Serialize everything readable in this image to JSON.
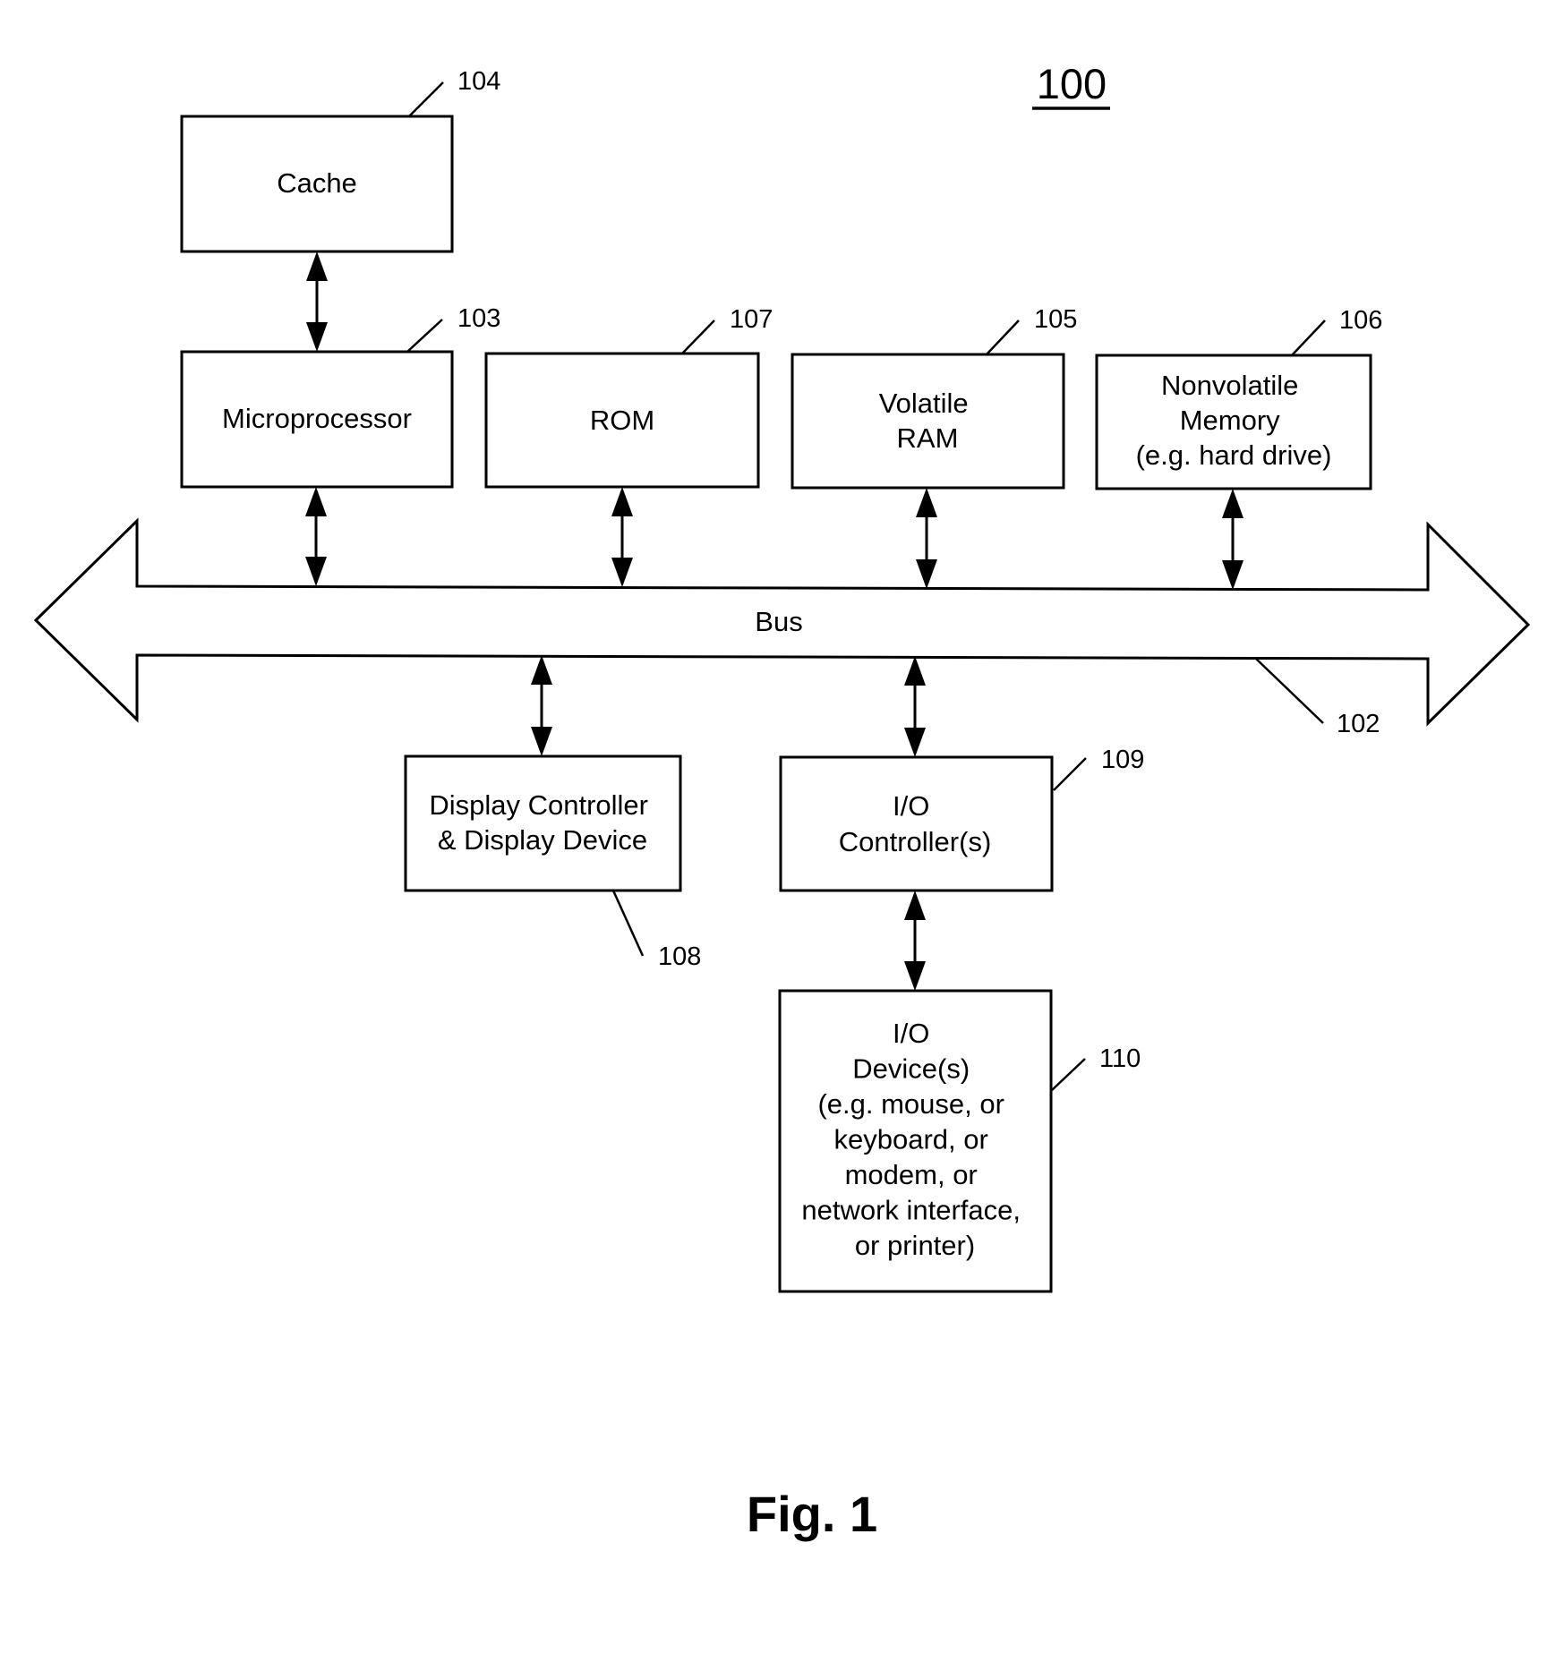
{
  "figure": {
    "number": "100",
    "caption": "Fig. 1"
  },
  "bus": {
    "label": "Bus",
    "ref": "102"
  },
  "blocks": {
    "cache": {
      "ref": "104",
      "lines": [
        "Cache"
      ]
    },
    "microprocessor": {
      "ref": "103",
      "lines": [
        "Microprocessor"
      ]
    },
    "rom": {
      "ref": "107",
      "lines": [
        "ROM"
      ]
    },
    "volatile_ram": {
      "ref": "105",
      "lines": [
        "Volatile",
        "RAM"
      ]
    },
    "nonvolatile_memory": {
      "ref": "106",
      "lines": [
        "Nonvolatile",
        "Memory",
        "(e.g. hard drive)"
      ]
    },
    "display": {
      "ref": "108",
      "lines": [
        "Display Controller",
        "& Display Device"
      ]
    },
    "io_controller": {
      "ref": "109",
      "lines": [
        "I/O",
        "Controller(s)"
      ]
    },
    "io_devices": {
      "ref": "110",
      "lines": [
        "I/O",
        "Device(s)",
        "(e.g. mouse, or",
        "keyboard, or",
        "modem, or",
        "network interface,",
        "or printer)"
      ]
    }
  },
  "connections": [
    {
      "from": "cache",
      "to": "microprocessor",
      "bidirectional": true
    },
    {
      "from": "microprocessor",
      "to": "bus",
      "bidirectional": true
    },
    {
      "from": "rom",
      "to": "bus",
      "bidirectional": true
    },
    {
      "from": "volatile_ram",
      "to": "bus",
      "bidirectional": true
    },
    {
      "from": "nonvolatile_memory",
      "to": "bus",
      "bidirectional": true
    },
    {
      "from": "bus",
      "to": "display",
      "bidirectional": true
    },
    {
      "from": "bus",
      "to": "io_controller",
      "bidirectional": true
    },
    {
      "from": "io_controller",
      "to": "io_devices",
      "bidirectional": true
    }
  ],
  "colors": {
    "stroke": "#000000",
    "background": "#ffffff"
  }
}
